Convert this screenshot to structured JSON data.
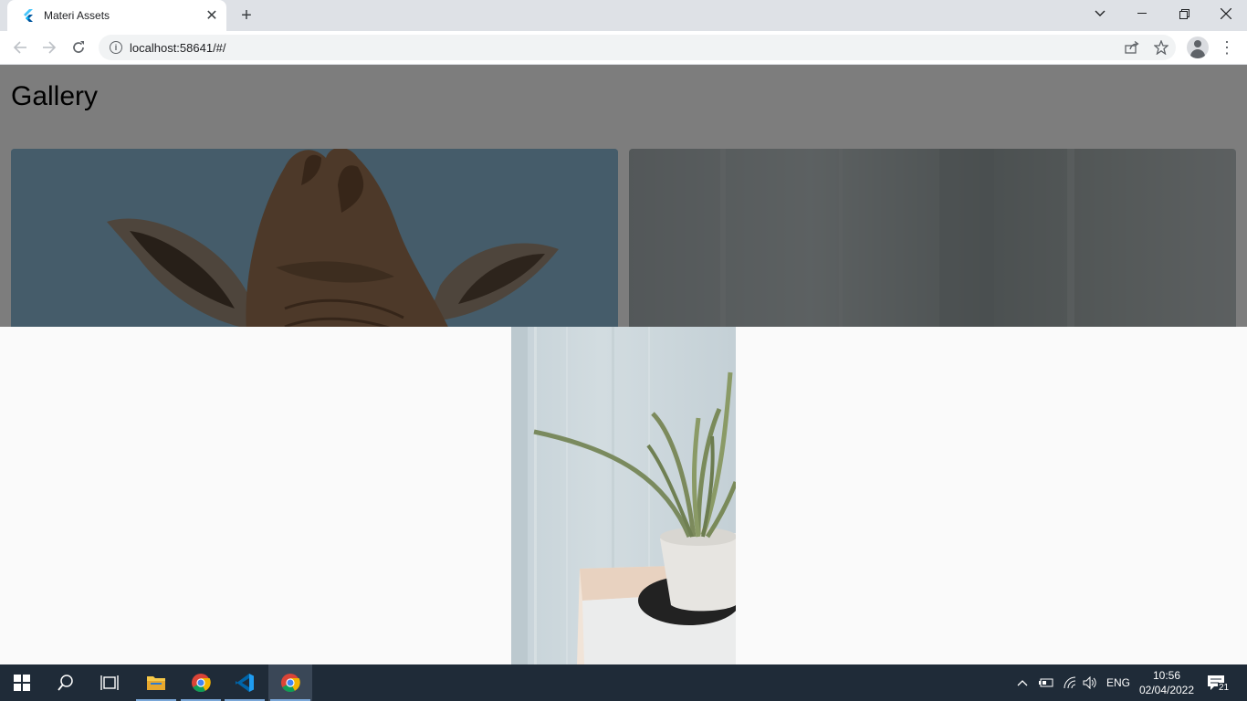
{
  "browser": {
    "tab_title": "Materi Assets",
    "url": "localhost:58641/#/"
  },
  "page": {
    "title": "Gallery"
  },
  "taskbar": {
    "language": "ENG",
    "time": "10:56",
    "date": "02/04/2022",
    "notification_count": "21"
  }
}
